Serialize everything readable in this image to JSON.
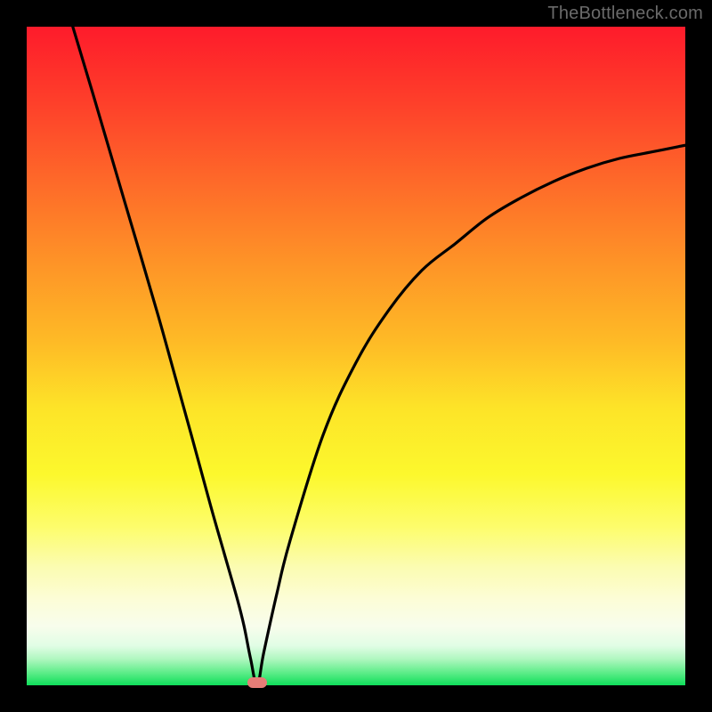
{
  "watermark": "TheBottleneck.com",
  "chart_data": {
    "type": "line",
    "title": "",
    "xlabel": "",
    "ylabel": "",
    "xlim": [
      0,
      100
    ],
    "ylim": [
      0,
      100
    ],
    "grid": false,
    "legend": false,
    "series": [
      {
        "name": "bottleneck-curve",
        "x": [
          7,
          10,
          15,
          20,
          25,
          28,
          30,
          32,
          33,
          34,
          35,
          36,
          38,
          40,
          45,
          50,
          55,
          60,
          65,
          70,
          75,
          80,
          85,
          90,
          95,
          100
        ],
        "values": [
          100,
          90,
          73,
          56,
          38,
          27,
          20,
          13,
          9,
          4,
          0,
          5,
          14,
          22,
          38,
          49,
          57,
          63,
          67,
          71,
          74,
          76.5,
          78.5,
          80,
          81,
          82
        ]
      }
    ],
    "minimum_marker": {
      "x": 35,
      "y": 0
    },
    "gradient_stops": [
      {
        "pos": 0,
        "color": "#fe1b2b"
      },
      {
        "pos": 12,
        "color": "#fe412a"
      },
      {
        "pos": 24,
        "color": "#fe6b29"
      },
      {
        "pos": 36,
        "color": "#fe9427"
      },
      {
        "pos": 48,
        "color": "#febb26"
      },
      {
        "pos": 58,
        "color": "#fde428"
      },
      {
        "pos": 68,
        "color": "#fcf82d"
      },
      {
        "pos": 76,
        "color": "#fdfd6c"
      },
      {
        "pos": 82,
        "color": "#fbfcb1"
      },
      {
        "pos": 87,
        "color": "#fcfdd7"
      },
      {
        "pos": 91,
        "color": "#f8fdec"
      },
      {
        "pos": 94,
        "color": "#e1fde5"
      },
      {
        "pos": 96,
        "color": "#b0f7c0"
      },
      {
        "pos": 98,
        "color": "#61ed8b"
      },
      {
        "pos": 100,
        "color": "#0fde5a"
      }
    ]
  }
}
